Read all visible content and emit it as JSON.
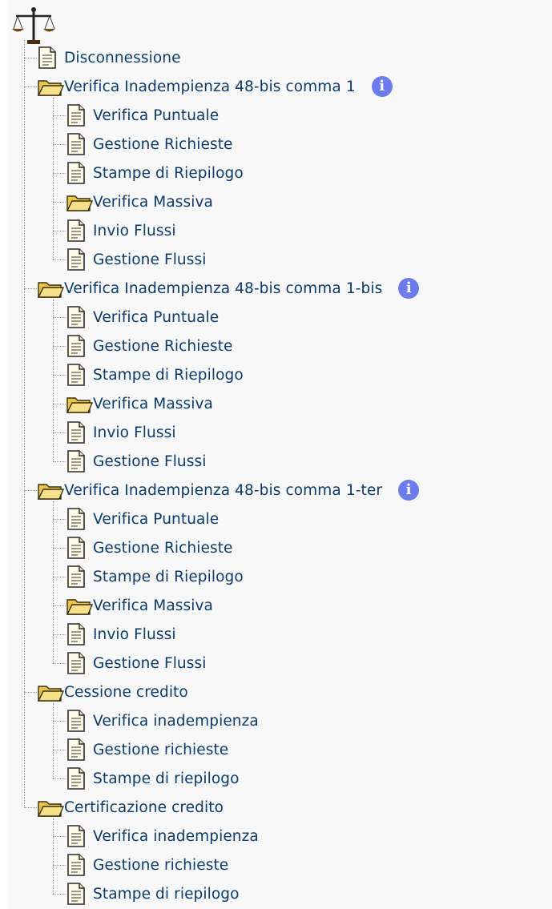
{
  "tree": {
    "items": [
      {
        "label": "Disconnessione"
      },
      {
        "label": "Verifica Inadempienza 48-bis comma 1",
        "info": "i",
        "children": [
          {
            "label": "Verifica Puntuale"
          },
          {
            "label": "Gestione Richieste"
          },
          {
            "label": "Stampe di Riepilogo"
          },
          {
            "label": "Verifica Massiva",
            "children": [
              {
                "label": "Invio Flussi"
              },
              {
                "label": "Gestione Flussi"
              }
            ]
          }
        ]
      },
      {
        "label": "Verifica Inadempienza 48-bis comma 1-bis",
        "info": "i",
        "children": [
          {
            "label": "Verifica Puntuale"
          },
          {
            "label": "Gestione Richieste"
          },
          {
            "label": "Stampe di Riepilogo"
          },
          {
            "label": "Verifica Massiva",
            "children": [
              {
                "label": "Invio Flussi"
              },
              {
                "label": "Gestione Flussi"
              }
            ]
          }
        ]
      },
      {
        "label": "Verifica Inadempienza 48-bis comma 1-ter",
        "info": "i",
        "children": [
          {
            "label": "Verifica Puntuale"
          },
          {
            "label": "Gestione Richieste"
          },
          {
            "label": "Stampe di Riepilogo"
          },
          {
            "label": "Verifica Massiva",
            "children": [
              {
                "label": "Invio Flussi"
              },
              {
                "label": "Gestione Flussi"
              }
            ]
          }
        ]
      },
      {
        "label": "Cessione credito",
        "children": [
          {
            "label": "Verifica inadempienza"
          },
          {
            "label": "Gestione richieste"
          },
          {
            "label": "Stampe di riepilogo"
          }
        ]
      },
      {
        "label": "Certificazione credito",
        "children": [
          {
            "label": "Verifica inadempienza"
          },
          {
            "label": "Gestione richieste"
          },
          {
            "label": "Stampe di riepilogo"
          }
        ]
      }
    ]
  },
  "colors": {
    "link": "#0c3a6b",
    "info": "#6d7cec",
    "folder": "#f3d76a"
  }
}
